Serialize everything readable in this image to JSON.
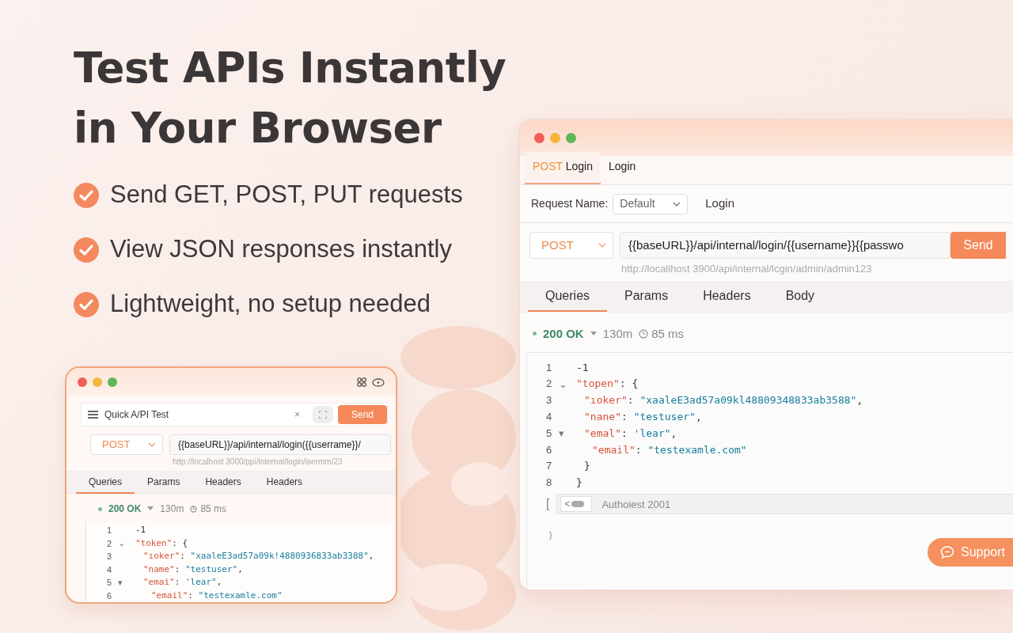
{
  "headline": [
    "Test APIs Instantly",
    "in Your Browser"
  ],
  "features": [
    {
      "text": "Send GET, POST, PUT requests"
    },
    {
      "text": "View JSON responses instantly"
    },
    {
      "text": "Lightweight, no setup needed"
    }
  ],
  "mini_window": {
    "title": "Quick A/PI Test",
    "close": "×",
    "send": "Send",
    "method": "POST",
    "url": "{{baseURL}}/api/internal/login({{userrame}}/",
    "resolved_url": "http://localhost 3000/ppi/internal/login/isermm/23",
    "tabs": [
      {
        "label": "Queries",
        "selected": true
      },
      {
        "label": "Params",
        "selected": false
      },
      {
        "label": "Headers",
        "selected": false
      },
      {
        "label": "Headers",
        "selected": false
      }
    ],
    "status": {
      "code": "200 OK",
      "size": "130m",
      "duration": "85 ms"
    },
    "code_lines": [
      {
        "number": "1",
        "parts": [
          {
            "kind": "punct",
            "text": "-1"
          }
        ]
      },
      {
        "number": "2",
        "fold": "⌄",
        "parts": [
          {
            "kind": "key",
            "text": "\"token\""
          },
          {
            "kind": "punct",
            "text": ": {"
          }
        ],
        "children": [
          {
            "number": "3",
            "parts": [
              {
                "kind": "key",
                "text": "\"ıoker\""
              },
              {
                "kind": "punct",
                "text": ": "
              },
              {
                "kind": "string",
                "text": "\"xaaleE3ad57a09k!4880936833ab3388\""
              },
              {
                "kind": "punct",
                "text": ","
              }
            ]
          },
          {
            "number": "4",
            "parts": [
              {
                "kind": "key",
                "text": "\"name\""
              },
              {
                "kind": "punct",
                "text": ": "
              },
              {
                "kind": "string",
                "text": "\"testuser\""
              },
              {
                "kind": "punct",
                "text": ","
              }
            ]
          },
          {
            "number": "5",
            "fold": "▾",
            "parts": [
              {
                "kind": "key",
                "text": "\"emai\""
              },
              {
                "kind": "punct",
                "text": ": "
              },
              {
                "kind": "string",
                "text": "'lear\""
              },
              {
                "kind": "punct",
                "text": ","
              }
            ],
            "children": [
              {
                "number": "6",
                "parts": [
                  {
                    "kind": "key",
                    "text": "\"email\""
                  },
                  {
                    "kind": "punct",
                    "text": ": "
                  },
                  {
                    "kind": "string",
                    "text": "\"testexamle.com\""
                  }
                ]
              }
            ]
          }
        ]
      }
    ]
  },
  "main_window": {
    "request_tabs": [
      {
        "method": "POST",
        "label": "Login",
        "selected": true
      },
      {
        "label": "Login",
        "selected": false
      }
    ],
    "request_name_label": "Request Name:",
    "request_name": "Default",
    "request_title": "Login",
    "method": "POST",
    "url": "{{baseURL}}/api/internal/login/{{username}}{{passwo",
    "send": "Send",
    "resolved_url": "http://locallhost 3900/api/internal/lcgin/admin/admin123",
    "tabs": [
      {
        "label": "Queries",
        "selected": true
      },
      {
        "label": "Params",
        "selected": false
      },
      {
        "label": "Headers",
        "selected": false
      },
      {
        "label": "Body",
        "selected": false
      }
    ],
    "status": {
      "code": "200 OK",
      "size": "130m",
      "duration": "85 ms"
    },
    "code_lines": [
      {
        "number": "1",
        "parts": [
          {
            "kind": "punct",
            "text": "-1"
          }
        ]
      },
      {
        "number": "2",
        "fold": "⌄",
        "parts": [
          {
            "kind": "key",
            "text": "\"topen\""
          },
          {
            "kind": "punct",
            "text": ": {"
          }
        ],
        "children": [
          {
            "number": "3",
            "parts": [
              {
                "kind": "key",
                "text": "\"ıoker\""
              },
              {
                "kind": "punct",
                "text": ": "
              },
              {
                "kind": "string",
                "text": "\"xaaleE3ad57a09kl48809348833ab3588\""
              },
              {
                "kind": "punct",
                "text": ","
              }
            ]
          },
          {
            "number": "4",
            "parts": [
              {
                "kind": "key",
                "text": "\"nane\""
              },
              {
                "kind": "punct",
                "text": ": "
              },
              {
                "kind": "string",
                "text": "\"testuser\""
              },
              {
                "kind": "punct",
                "text": ","
              }
            ]
          },
          {
            "number": "5",
            "fold": "▾",
            "parts": [
              {
                "kind": "key",
                "text": "\"emal\""
              },
              {
                "kind": "punct",
                "text": ": "
              },
              {
                "kind": "string",
                "text": "'lear\""
              },
              {
                "kind": "punct",
                "text": ","
              }
            ],
            "children": [
              {
                "number": "6",
                "parts": [
                  {
                    "kind": "key",
                    "text": "\"email\""
                  },
                  {
                    "kind": "punct",
                    "text": ": "
                  },
                  {
                    "kind": "string",
                    "text": "\"testexamle.com\""
                  }
                ]
              }
            ]
          },
          {
            "number": "7",
            "parts": [
              {
                "kind": "punct",
                "text": "}"
              }
            ]
          }
        ]
      },
      {
        "number": "8",
        "parts": [
          {
            "kind": "punct",
            "text": "}"
          }
        ]
      }
    ],
    "footer": {
      "bracket": "[",
      "back": "<",
      "text": "Authoiest 2001"
    },
    "trailing_brace": "}"
  },
  "support_button": "Support"
}
